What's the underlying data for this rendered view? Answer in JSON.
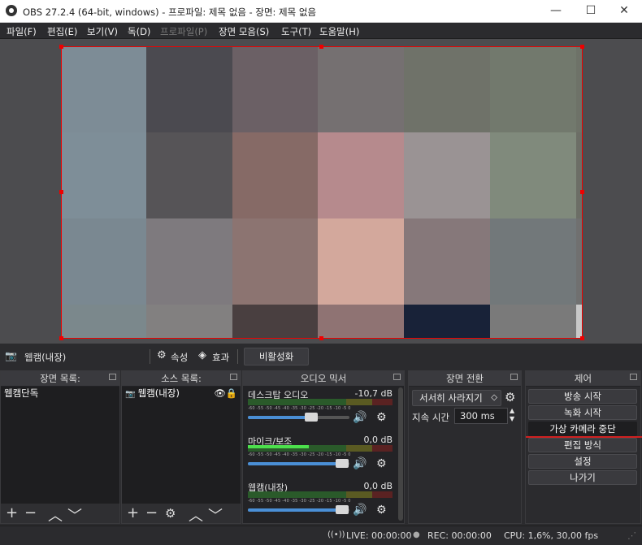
{
  "window": {
    "title": "OBS 27.2.4 (64-bit, windows) - 프로파일: 제목 없음 - 장면: 제목 없음",
    "minimize": "—",
    "maximize": "☐",
    "close": "✕"
  },
  "menu": [
    "파일(F)",
    "편집(E)",
    "보기(V)",
    "독(D)",
    "프로파일(P)",
    "장면 모음(S)",
    "도구(T)",
    "도움말(H)"
  ],
  "preview": {
    "tiles": [
      [
        "#7d8c96",
        "#4b4a50",
        "#6b6065",
        "#757071",
        "#6f7269",
        "#72796d",
        "#6e7268"
      ],
      [
        "#7e8e98",
        "#565457",
        "#866a66",
        "#b68a8d",
        "#9a9394",
        "#808a7c",
        "#6c6e66"
      ],
      [
        "#7a8891",
        "#7e7a7e",
        "#8c7471",
        "#d3a89c",
        "#86787a",
        "#72787a",
        "#707070"
      ],
      [
        "#7b888c",
        "#828080",
        "#493f40",
        "#8f7373",
        "#182238",
        "#7a7a7a",
        "#c8c8c8"
      ]
    ]
  },
  "context": {
    "source_name": "웹캠(내장)",
    "properties": "속성",
    "filters": "효과",
    "deactivate": "비활성화"
  },
  "scenes": {
    "title": "장면 목록",
    "items": [
      "웹캠단독"
    ]
  },
  "sources": {
    "title": "소스 목록",
    "items": [
      "웹캠(내장)"
    ]
  },
  "mixer": {
    "title": "오디오 믹서",
    "ticks": "-60 -55 -50 -45 -40 -35 -30 -25 -20 -15 -10 -5 0",
    "channels": [
      {
        "name": "데스크탑 오디오",
        "db": "-10,7 dB",
        "level": 0,
        "volume": 0.62
      },
      {
        "name": "마이크/보조",
        "db": "0,0 dB",
        "level": 0.42,
        "volume": 0.93
      },
      {
        "name": "웹캠(내장)",
        "db": "0,0 dB",
        "level": 0,
        "volume": 0.93
      }
    ]
  },
  "transitions": {
    "title": "장면 전환",
    "type": "서서히 사라지기",
    "duration_label": "지속 시간",
    "duration": "300 ms"
  },
  "controls": {
    "title": "제어",
    "buttons": [
      "방송 시작",
      "녹화 시작",
      "가상 카메라 중단",
      "편집 방식",
      "설정",
      "나가기"
    ]
  },
  "status": {
    "live": "LIVE: 00:00:00",
    "rec": "REC: 00:00:00",
    "cpu": "CPU: 1,6%, 30,00 fps"
  },
  "colors": {
    "accent": "#4a8fd6",
    "selection": "#e00000",
    "active_underline": "#d02020"
  }
}
